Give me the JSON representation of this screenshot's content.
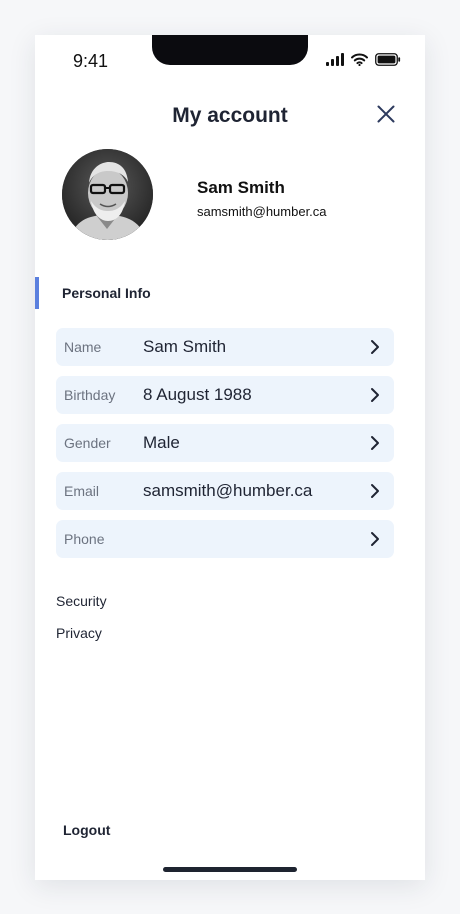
{
  "status_bar": {
    "time": "9:41"
  },
  "header": {
    "title": "My account"
  },
  "profile": {
    "name": "Sam Smith",
    "email": "samsmith@humber.ca"
  },
  "personal_info": {
    "title": "Personal Info",
    "rows": [
      {
        "label": "Name",
        "value": "Sam Smith"
      },
      {
        "label": "Birthday",
        "value": "8 August 1988"
      },
      {
        "label": "Gender",
        "value": "Male"
      },
      {
        "label": "Email",
        "value": "samsmith@humber.ca"
      },
      {
        "label": "Phone",
        "value": ""
      }
    ]
  },
  "links": {
    "security": "Security",
    "privacy": "Privacy"
  },
  "footer": {
    "logout": "Logout"
  },
  "colors": {
    "accent": "#5b7fde",
    "row_background": "#edf4fc",
    "text": "#1f2433"
  },
  "icons": {
    "close": "close-icon",
    "chevron": "chevron-right-icon"
  }
}
